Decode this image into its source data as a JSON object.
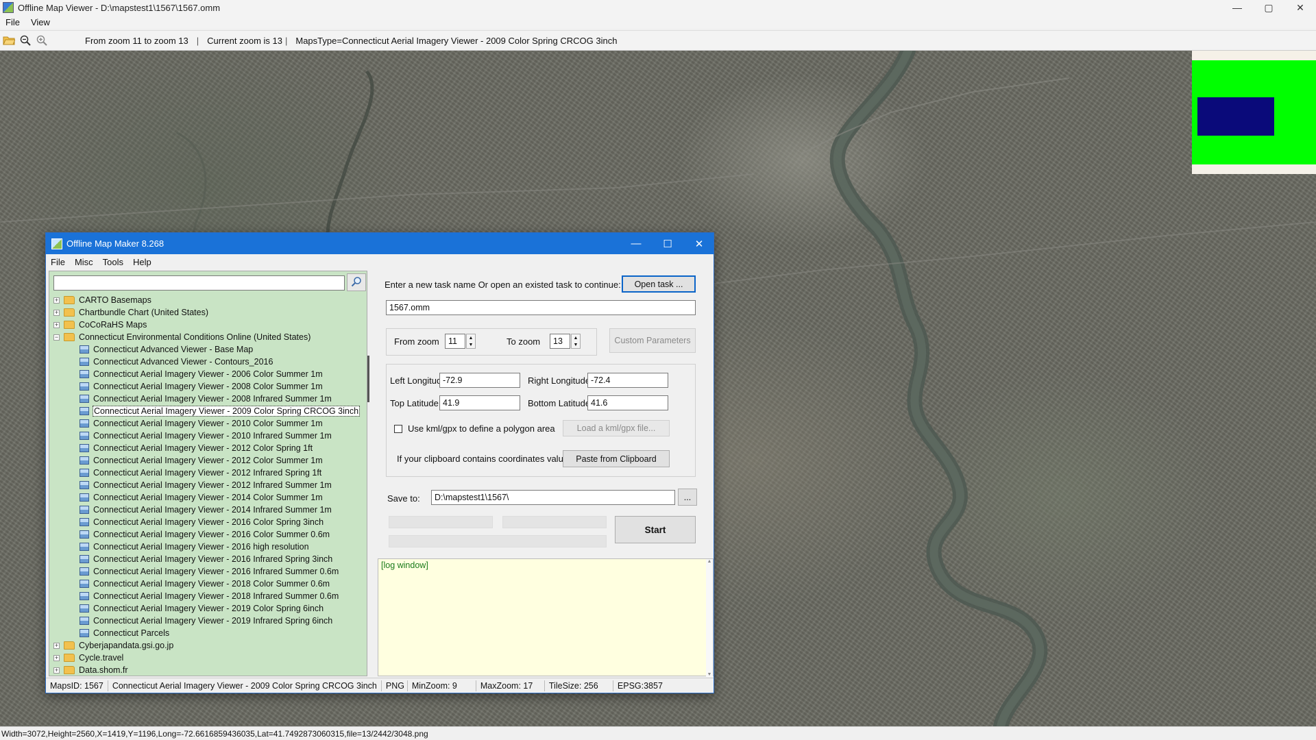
{
  "window": {
    "title": "Offline Map Viewer - D:\\mapstest1\\1567\\1567.omm",
    "controls": {
      "minimize": "—",
      "maximize": "▢",
      "close": "✕"
    }
  },
  "menu": {
    "file": "File",
    "view": "View"
  },
  "toolbar": {
    "zoom_range": "From zoom 11 to zoom 13",
    "sep": "|",
    "current_zoom": "Current zoom is 13",
    "maps_type": "MapsType=Connecticut Aerial Imagery Viewer - 2009 Color Spring CRCOG 3inch"
  },
  "overview_colors": {
    "background": "#00ff00",
    "viewport": "#0a0a7a"
  },
  "statusbar": {
    "text": "Width=3072,Height=2560,X=1419,Y=1196,Long=-72.6616859436035,Lat=41.7492873060315,file=13/2442/3048.png"
  },
  "dialog": {
    "title": "Offline Map Maker 8.268",
    "controls": {
      "minimize": "—",
      "maximize": "☐",
      "close": "✕"
    },
    "menu": [
      "File",
      "Misc",
      "Tools",
      "Help"
    ],
    "search": {
      "value": ""
    },
    "tree": [
      {
        "level": 0,
        "type": "folder",
        "expander": "+",
        "label": "CARTO Basemaps"
      },
      {
        "level": 0,
        "type": "folder",
        "expander": "+",
        "label": "Chartbundle Chart (United States)"
      },
      {
        "level": 0,
        "type": "folder",
        "expander": "+",
        "label": "CoCoRaHS Maps"
      },
      {
        "level": 0,
        "type": "folder",
        "expander": "−",
        "label": "Connecticut Environmental Conditions Online (United States)"
      },
      {
        "level": 1,
        "type": "map",
        "label": "Connecticut Advanced Viewer - Base Map"
      },
      {
        "level": 1,
        "type": "map",
        "label": "Connecticut Advanced Viewer - Contours_2016"
      },
      {
        "level": 1,
        "type": "map",
        "label": "Connecticut Aerial Imagery Viewer - 2006 Color Summer 1m"
      },
      {
        "level": 1,
        "type": "map",
        "label": "Connecticut Aerial Imagery Viewer - 2008 Color Summer 1m"
      },
      {
        "level": 1,
        "type": "map",
        "label": "Connecticut Aerial Imagery Viewer - 2008 Infrared Summer 1m"
      },
      {
        "level": 1,
        "type": "map",
        "label": "Connecticut Aerial Imagery Viewer - 2009 Color Spring CRCOG 3inch",
        "selected": true
      },
      {
        "level": 1,
        "type": "map",
        "label": "Connecticut Aerial Imagery Viewer - 2010 Color Summer 1m"
      },
      {
        "level": 1,
        "type": "map",
        "label": "Connecticut Aerial Imagery Viewer - 2010 Infrared Summer 1m"
      },
      {
        "level": 1,
        "type": "map",
        "label": "Connecticut Aerial Imagery Viewer - 2012 Color Spring 1ft"
      },
      {
        "level": 1,
        "type": "map",
        "label": "Connecticut Aerial Imagery Viewer - 2012 Color Summer 1m"
      },
      {
        "level": 1,
        "type": "map",
        "label": "Connecticut Aerial Imagery Viewer - 2012 Infrared Spring 1ft"
      },
      {
        "level": 1,
        "type": "map",
        "label": "Connecticut Aerial Imagery Viewer - 2012 Infrared Summer 1m"
      },
      {
        "level": 1,
        "type": "map",
        "label": "Connecticut Aerial Imagery Viewer - 2014 Color Summer 1m"
      },
      {
        "level": 1,
        "type": "map",
        "label": "Connecticut Aerial Imagery Viewer - 2014 Infrared Summer 1m"
      },
      {
        "level": 1,
        "type": "map",
        "label": "Connecticut Aerial Imagery Viewer - 2016 Color Spring 3inch"
      },
      {
        "level": 1,
        "type": "map",
        "label": "Connecticut Aerial Imagery Viewer - 2016 Color Summer 0.6m"
      },
      {
        "level": 1,
        "type": "map",
        "label": "Connecticut Aerial Imagery Viewer - 2016 high resolution"
      },
      {
        "level": 1,
        "type": "map",
        "label": "Connecticut Aerial Imagery Viewer - 2016 Infrared Spring 3inch"
      },
      {
        "level": 1,
        "type": "map",
        "label": "Connecticut Aerial Imagery Viewer - 2016 Infrared Summer 0.6m"
      },
      {
        "level": 1,
        "type": "map",
        "label": "Connecticut Aerial Imagery Viewer - 2018 Color Summer 0.6m"
      },
      {
        "level": 1,
        "type": "map",
        "label": "Connecticut Aerial Imagery Viewer - 2018 Infrared Summer 0.6m"
      },
      {
        "level": 1,
        "type": "map",
        "label": "Connecticut Aerial Imagery Viewer - 2019 Color Spring 6inch"
      },
      {
        "level": 1,
        "type": "map",
        "label": "Connecticut Aerial Imagery Viewer - 2019 Infrared Spring 6inch"
      },
      {
        "level": 1,
        "type": "map",
        "label": "Connecticut Parcels"
      },
      {
        "level": 0,
        "type": "folder",
        "expander": "+",
        "label": "Cyberjapandata.gsi.go.jp"
      },
      {
        "level": 0,
        "type": "folder",
        "expander": "+",
        "label": "Cycle.travel"
      },
      {
        "level": 0,
        "type": "folder",
        "expander": "+",
        "label": "Data.shom.fr"
      }
    ],
    "task_prompt": "Enter a new task name Or open an existed task to continue:",
    "open_task_button": "Open task ...",
    "task_name": "1567.omm",
    "from_zoom_label": "From zoom",
    "from_zoom": "11",
    "to_zoom_label": "To zoom",
    "to_zoom": "13",
    "custom_params_button": "Custom Parameters",
    "left_lon_label": "Left Longitude",
    "left_lon": "-72.9",
    "right_lon_label": "Right Longitude",
    "right_lon": "-72.4",
    "top_lat_label": "Top Latitude",
    "top_lat": "41.9",
    "bottom_lat_label": "Bottom Latitude",
    "bottom_lat": "41.6",
    "kml_checkbox_label": "Use kml/gpx to define a polygon area",
    "load_kml_button": "Load a kml/gpx file...",
    "clipboard_label": "If your clipboard contains coordinates values:",
    "paste_button": "Paste from Clipboard",
    "save_to_label": "Save to:",
    "save_to": "D:\\mapstest1\\1567\\",
    "browse_button": "...",
    "start_button": "Start",
    "log_text": "[log window]",
    "status": {
      "maps_id": "MapsID: 1567",
      "map_name": "Connecticut Aerial Imagery Viewer - 2009 Color Spring CRCOG 3inch",
      "format": "PNG",
      "min_zoom": "MinZoom: 9",
      "max_zoom": "MaxZoom: 17",
      "tile_size": "TileSize: 256",
      "epsg": "EPSG:3857"
    }
  }
}
